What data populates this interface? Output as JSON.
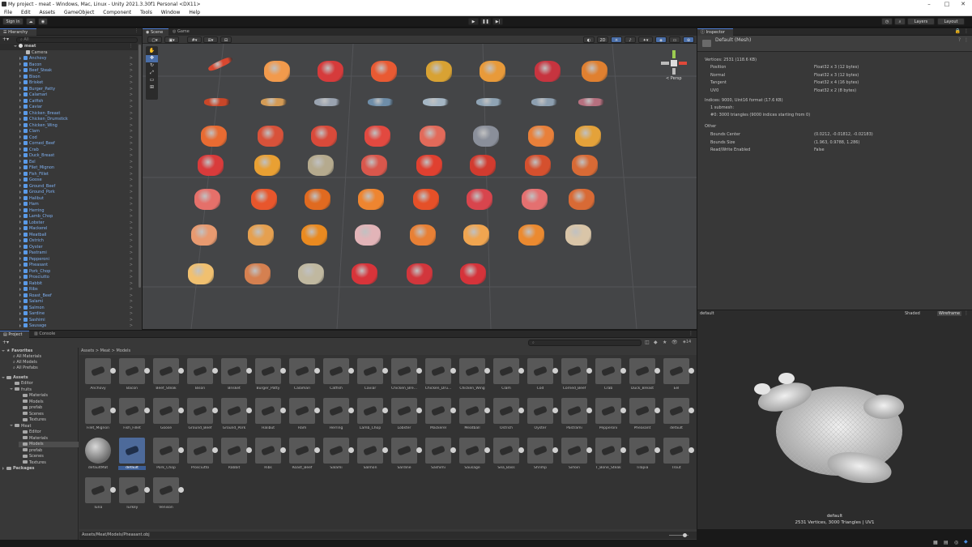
{
  "window": {
    "title": "My project - meat - Windows, Mac, Linux - Unity 2021.3.30f1 Personal <DX11>"
  },
  "menu": [
    "File",
    "Edit",
    "Assets",
    "GameObject",
    "Component",
    "Tools",
    "Window",
    "Help"
  ],
  "toolbar": {
    "sign_in": "Sign in",
    "layers": "Layers",
    "layout": "Layout"
  },
  "hierarchy": {
    "tab": "Hierarchy",
    "search_placeholder": "All",
    "scene": "meat",
    "items": [
      "Camera",
      "Anchovy",
      "Bacon",
      "Beef_Steak",
      "Bison",
      "Brisket",
      "Burger_Patty",
      "Calamari",
      "Catfish",
      "Caviar",
      "Chicken_Breast",
      "Chicken_Drumstick",
      "Chicken_Wing",
      "Clam",
      "Cod",
      "Corned_Beef",
      "Crab",
      "Duck_Breast",
      "Eel",
      "Filet_Mignon",
      "Fish_Fillet",
      "Goose",
      "Ground_Beef",
      "Ground_Pork",
      "Halibut",
      "Ham",
      "Herring",
      "Lamb_Chop",
      "Lobster",
      "Mackerel",
      "Meatball",
      "Ostrich",
      "Oyster",
      "Pastrami",
      "Pepperoni",
      "Pheasant",
      "Pork_Chop",
      "Prosciutto",
      "Rabbit",
      "Ribs",
      "Roast_Beef",
      "Salami",
      "Salmon",
      "Sardine",
      "Sashimi",
      "Sausage"
    ]
  },
  "scene_view": {
    "tabs": [
      "Scene",
      "Game"
    ],
    "mode_2d": "2D",
    "persp": "< Persp"
  },
  "inspector": {
    "tab": "Inspector",
    "title": "Default (Mesh)",
    "vertices_header": "Vertices: 2531 (118.6 KB)",
    "vertex_attrs": [
      {
        "name": "Position",
        "value": "Float32 x 3 (12 bytes)"
      },
      {
        "name": "Normal",
        "value": "Float32 x 3 (12 bytes)"
      },
      {
        "name": "Tangent",
        "value": "Float32 x 4 (16 bytes)"
      },
      {
        "name": "UV0",
        "value": "Float32 x 2 (8 bytes)"
      }
    ],
    "indices_header": "Indices: 9000, Uint16 format (17.6 KB)",
    "submesh": "1 submesh:",
    "submesh_detail": "#0: 3000 triangles (9000 indices starting from 0)",
    "other_header": "Other",
    "other": [
      {
        "name": "Bounds Center",
        "value": "(0.0212, -0.01812, -0.02183)"
      },
      {
        "name": "Bounds Size",
        "value": "(1.963, 0.9788, 1.286)"
      },
      {
        "name": "Read/Write Enabled",
        "value": "False"
      }
    ],
    "preview_name": "default",
    "shaded": "Shaded",
    "wireframe": "Wireframe",
    "preview_caption_1": "default",
    "preview_caption_2": "2531 Vertices, 3000 Triangles | UV1"
  },
  "project": {
    "tabs": [
      "Project",
      "Console"
    ],
    "breadcrumb": [
      "Assets",
      "Meat",
      "Models"
    ],
    "count": "14",
    "favorites": {
      "label": "Favorites",
      "items": [
        "All Materials",
        "All Models",
        "All Prefabs"
      ]
    },
    "assets_tree": {
      "label": "Assets",
      "items": [
        {
          "name": "Editor",
          "depth": 1
        },
        {
          "name": "fruits",
          "depth": 1
        },
        {
          "name": "Materials",
          "depth": 2
        },
        {
          "name": "Models",
          "depth": 2
        },
        {
          "name": "prefab",
          "depth": 2
        },
        {
          "name": "Scenes",
          "depth": 2
        },
        {
          "name": "Textures",
          "depth": 2
        },
        {
          "name": "Meat",
          "depth": 1
        },
        {
          "name": "Editor",
          "depth": 2
        },
        {
          "name": "Materials",
          "depth": 2
        },
        {
          "name": "Models",
          "depth": 2
        },
        {
          "name": "prefab",
          "depth": 2
        },
        {
          "name": "Scenes",
          "depth": 2
        },
        {
          "name": "Textures",
          "depth": 2
        }
      ]
    },
    "packages": "Packages",
    "assets": [
      "Anchovy",
      "Bacon",
      "Beef_Steak",
      "Bison",
      "Brisket",
      "Burger_Patty",
      "Calamari",
      "Catfish",
      "Caviar",
      "Chicken_Bre...",
      "Chicken_Dru...",
      "Chicken_Wing",
      "Clam",
      "Cod",
      "Corned_Beef",
      "Crab",
      "Duck_Breast",
      "Eel",
      "Filet_Mignon",
      "Fish_Fillet",
      "Goose",
      "Ground_Beef",
      "Ground_Pork",
      "Halibut",
      "Ham",
      "Herring",
      "Lamb_Chop",
      "Lobster",
      "Mackerel",
      "Meatball",
      "Ostrich",
      "Oyster",
      "Pastrami",
      "Pepperoni",
      "Pheasant",
      "default",
      "defaultMat",
      "default",
      "Pork_Chop",
      "Prosciutto",
      "Rabbit",
      "Ribs",
      "Roast_Beef",
      "Salami",
      "Salmon",
      "Sardine",
      "Sashimi",
      "Sausage",
      "Sea_Bass",
      "Shrimp",
      "Sirloin",
      "T_Bone_Steak",
      "Tilapia",
      "Trout",
      "Tuna",
      "Turkey",
      "Venison"
    ],
    "status_path": "Assets/Meat/Models/Pheasant.obj"
  }
}
